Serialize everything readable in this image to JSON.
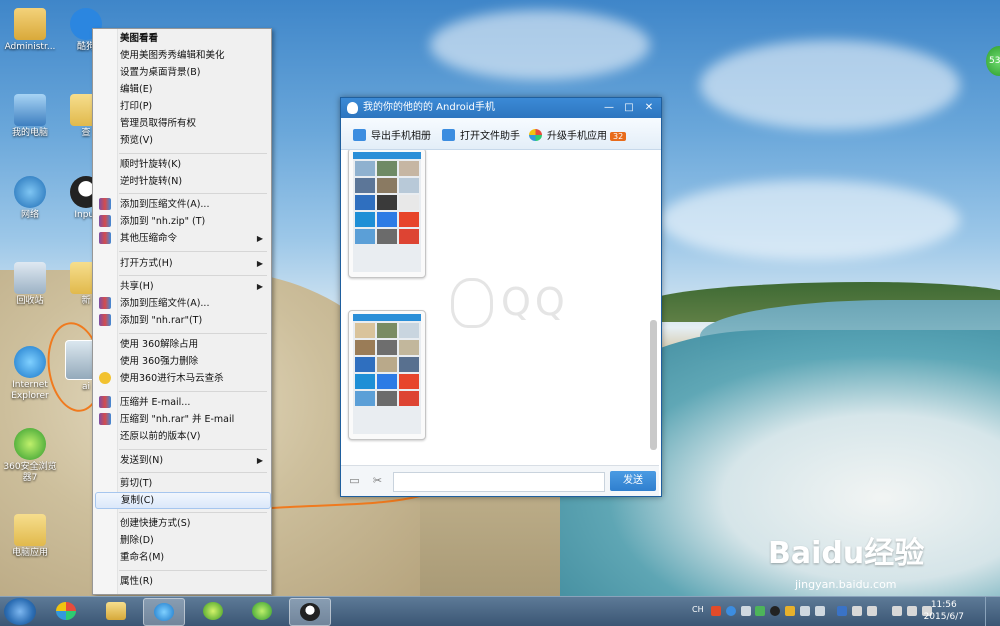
{
  "desktop": {
    "icons": [
      {
        "label": "Administr...",
        "icon": "user-folder-icon"
      },
      {
        "label": "酷狗",
        "icon": "kugou-icon"
      },
      {
        "label": "我的电脑",
        "icon": "computer-icon"
      },
      {
        "label": "查",
        "icon": "folder-icon"
      },
      {
        "label": "网络",
        "icon": "network-icon"
      },
      {
        "label": "Input",
        "icon": "penguin-icon"
      },
      {
        "label": "回收站",
        "icon": "recycle-bin-icon"
      },
      {
        "label": "新",
        "icon": "folder-icon"
      },
      {
        "label": "Internet Explorer",
        "icon": "ie-icon"
      },
      {
        "label": "ai",
        "icon": "image-file-icon"
      },
      {
        "label": "360安全浏览器7",
        "icon": "360-browser-icon"
      },
      {
        "label": "电脑应用",
        "icon": "folder-icon"
      }
    ],
    "edge_badge": "53",
    "watermark": "Baidu经验",
    "watermark_url": "jingyan.baidu.com"
  },
  "context_menu": {
    "items": [
      {
        "label": "美图看看",
        "bold": true
      },
      {
        "label": "使用美图秀秀编辑和美化"
      },
      {
        "label": "设置为桌面背景(B)"
      },
      {
        "label": "编辑(E)"
      },
      {
        "label": "打印(P)"
      },
      {
        "label": "管理员取得所有权"
      },
      {
        "label": "预览(V)"
      },
      {
        "label": "顺时针旋转(K)"
      },
      {
        "label": "逆时针旋转(N)"
      },
      {
        "label": "添加到压缩文件(A)..."
      },
      {
        "label": "添加到 \"nh.zip\" (T)"
      },
      {
        "label": "其他压缩命令"
      },
      {
        "label": "打开方式(H)"
      },
      {
        "label": "共享(H)"
      },
      {
        "label": "添加到压缩文件(A)..."
      },
      {
        "label": "添加到 \"nh.rar\"(T)"
      },
      {
        "label": "使用 360解除占用"
      },
      {
        "label": "使用 360强力删除"
      },
      {
        "label": "使用360进行木马云查杀"
      },
      {
        "label": "压缩并 E-mail..."
      },
      {
        "label": "压缩到 \"nh.rar\" 并 E-mail"
      },
      {
        "label": "还原以前的版本(V)"
      },
      {
        "label": "发送到(N)"
      },
      {
        "label": "剪切(T)"
      },
      {
        "label": "复制(C)"
      },
      {
        "label": "创建快捷方式(S)"
      },
      {
        "label": "删除(D)"
      },
      {
        "label": "重命名(M)"
      },
      {
        "label": "属性(R)"
      }
    ]
  },
  "qq_window": {
    "title": "我的你的他的的 Android手机",
    "minimize": "—",
    "maximize": "□",
    "close": "✕",
    "toolbar": {
      "export": "导出手机相册",
      "file_helper": "打开文件助手",
      "upgrade": "升级手机应用",
      "upgrade_badge": "32"
    },
    "watermark": "QQ",
    "input_placeholder": "",
    "send": "发送"
  },
  "taskbar": {
    "time": "11:56",
    "date": "2015/6/7",
    "lang": "CH"
  }
}
